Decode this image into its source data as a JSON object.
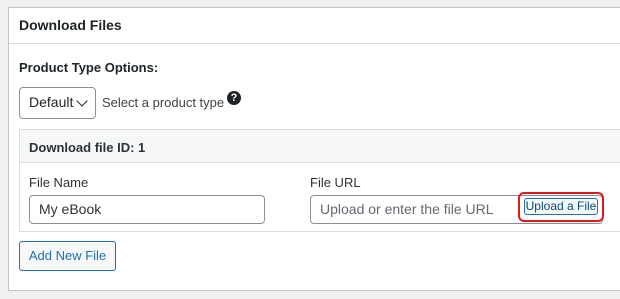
{
  "panel": {
    "title": "Download Files"
  },
  "product_type": {
    "label": "Product Type Options:",
    "selected": "Default",
    "hint": "Select a product type",
    "help_icon": "question-circle-icon"
  },
  "file": {
    "header": "Download file ID: 1",
    "name_label": "File Name",
    "name_value": "My eBook",
    "url_label": "File URL",
    "url_placeholder": "Upload or enter the file URL",
    "upload_label": "Upload a File"
  },
  "actions": {
    "add_new_label": "Add New File"
  },
  "colors": {
    "highlight": "#e01a1a",
    "accent": "#2271b1"
  }
}
